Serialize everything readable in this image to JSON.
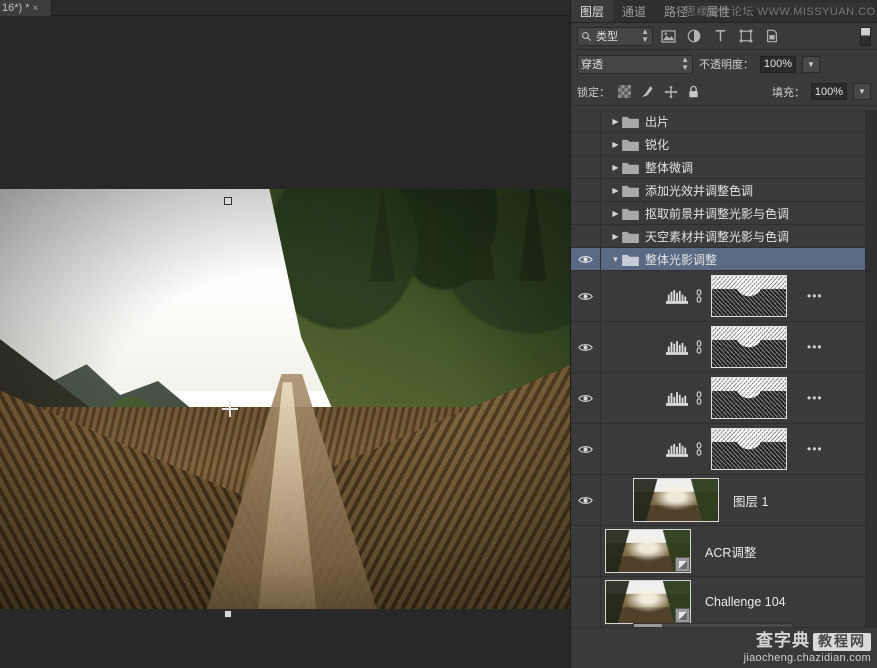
{
  "document": {
    "tab_title": "16*)",
    "modified_marker": "*",
    "close_label": "×"
  },
  "panel": {
    "tabs": [
      {
        "label": "图层",
        "active": true
      },
      {
        "label": "通道",
        "active": false
      },
      {
        "label": "路径",
        "active": false
      },
      {
        "label": "属性",
        "active": false
      }
    ],
    "watermark_top": "思缘设计论坛 WWW.MISSYUAN.COM",
    "filter": {
      "kind_label": "类型",
      "search_icon": "search-icon",
      "icons": [
        "pixel-layer-filter-icon",
        "adjustment-layer-filter-icon",
        "type-layer-filter-icon",
        "shape-layer-filter-icon",
        "smart-object-filter-icon"
      ],
      "toggle": "filter-toggle-switch"
    },
    "blend": {
      "mode": "穿透",
      "opacity_label": "不透明度：",
      "opacity_value": "100%"
    },
    "lock": {
      "label": "锁定：",
      "icons": [
        "lock-transparent-pixels-icon",
        "lock-image-pixels-icon",
        "lock-position-icon",
        "lock-all-icon"
      ],
      "fill_label": "填充：",
      "fill_value": "100%"
    }
  },
  "layers": [
    {
      "name": "出片",
      "type": "group",
      "visible": false,
      "expanded": false,
      "selected": false
    },
    {
      "name": "锐化",
      "type": "group",
      "visible": false,
      "expanded": false,
      "selected": false
    },
    {
      "name": "整体微调",
      "type": "group",
      "visible": false,
      "expanded": false,
      "selected": false
    },
    {
      "name": "添加光效并调整色调",
      "type": "group",
      "visible": false,
      "expanded": false,
      "selected": false
    },
    {
      "name": "抠取前景并调整光影与色调",
      "type": "group",
      "visible": false,
      "expanded": false,
      "selected": false
    },
    {
      "name": "天空素材并调整光影与色调",
      "type": "group",
      "visible": false,
      "expanded": false,
      "selected": false
    },
    {
      "name": "整体光影调整",
      "type": "group",
      "visible": true,
      "expanded": true,
      "selected": true
    },
    {
      "name": "",
      "type": "adjustment",
      "adj_icon": "levels-icon",
      "visible": true,
      "linked": true,
      "overflow": "•••"
    },
    {
      "name": "",
      "type": "adjustment",
      "adj_icon": "levels-icon",
      "visible": true,
      "linked": true,
      "overflow": "•••"
    },
    {
      "name": "",
      "type": "adjustment",
      "adj_icon": "levels-icon",
      "visible": true,
      "linked": true,
      "overflow": "•••"
    },
    {
      "name": "",
      "type": "adjustment",
      "adj_icon": "levels-icon",
      "visible": true,
      "linked": true,
      "overflow": "•••"
    },
    {
      "name": "图层 1",
      "type": "image",
      "visible": true,
      "smart_object": false
    },
    {
      "name": "ACR调整",
      "type": "image",
      "visible": false,
      "smart_object": true
    },
    {
      "name": "Challenge 104",
      "type": "image",
      "visible": false,
      "smart_object": true
    }
  ],
  "watermark_bottom": {
    "cn": "查字典",
    "box": "教程网",
    "url": "jiaocheng.chazidian.com"
  },
  "colors": {
    "panel_bg": "#3a3a3a",
    "selection": "#5b6a84",
    "app_bg": "#282828",
    "text": "#e3e3e3"
  }
}
